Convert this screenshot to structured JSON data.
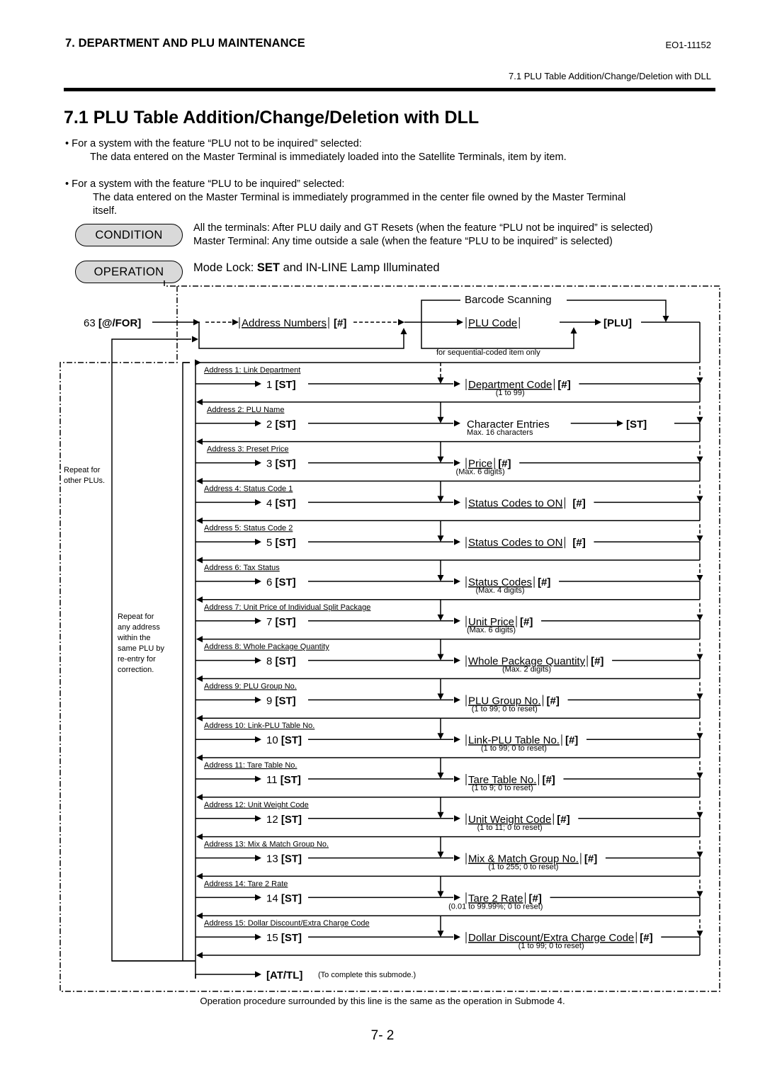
{
  "header": {
    "section": "7. DEPARTMENT AND PLU MAINTENANCE",
    "doc_code": "EO1-11152",
    "subheading": "7.1 PLU Table Addition/Change/Deletion with DLL"
  },
  "title": "7.1  PLU Table Addition/Change/Deletion with DLL",
  "bullets": [
    {
      "lead": "• For a system with the feature “PLU not to be inquired” selected:",
      "body": "The data entered on the Master Terminal is immediately loaded into the Satellite Terminals, item by item."
    },
    {
      "lead": "• For a system with the feature “PLU to be inquired” selected:",
      "body": "The data entered on the Master Terminal is immediately programmed  in the center file owned by the Master Terminal",
      "body2": "itself."
    }
  ],
  "condition": {
    "label": "CONDITION",
    "line1": "All the terminals: After PLU daily and GT Resets (when the feature “PLU not be inquired” is selected)",
    "line2": "Master Terminal: Any time outside a sale (when the feature “PLU to be inquired” is selected)"
  },
  "operation": {
    "label": "OPERATION",
    "prefix": "Mode Lock: ",
    "bold": "SET",
    "suffix": " and IN-LINE Lamp Illuminated"
  },
  "flow": {
    "start_num": "63 ",
    "start_key": "[@/FOR]",
    "address_numbers": "Address Numbers",
    "hash_key": "[#]",
    "barcode_scanning": "Barcode Scanning",
    "plu_code": "PLU Code",
    "plu_key": "[PLU]",
    "sequential_note": "for sequential-coded item only",
    "repeat_other": [
      "Repeat for",
      "other PLUs."
    ],
    "repeat_any": [
      "Repeat for",
      "any address",
      "within the",
      "same PLU by",
      "re-entry for",
      "correction."
    ],
    "end_key": "[AT/TL]",
    "end_note": "(To complete this submode.)",
    "st_key": "[ST]",
    "rows": [
      {
        "num": "1",
        "address": "Address 1: Link Department",
        "entry": "Department Code",
        "boxed": true,
        "hash": true,
        "note": "(1 to 99)"
      },
      {
        "num": "2",
        "address": "Address 2: PLU Name",
        "entry": "Character Entries",
        "boxed": false,
        "hash": false,
        "st_after": true,
        "note": "Max. 16 characters"
      },
      {
        "num": "3",
        "address": "Address 3: Preset Price",
        "entry": "Price",
        "boxed": true,
        "hash": true,
        "note": "(Max. 6 digits)"
      },
      {
        "num": "4",
        "address": "Address 4: Status Code 1",
        "entry": "Status Codes to ON",
        "boxed": true,
        "hash": true,
        "note": ""
      },
      {
        "num": "5",
        "address": "Address 5: Status Code 2",
        "entry": "Status Codes to ON",
        "boxed": true,
        "hash": true,
        "note": ""
      },
      {
        "num": "6",
        "address": "Address 6: Tax Status",
        "entry": "Status Codes",
        "boxed": true,
        "hash": true,
        "note": "(Max. 4 digits)"
      },
      {
        "num": "7",
        "address": "Address 7: Unit Price of Individual Split Package",
        "entry": "Unit Price",
        "boxed": true,
        "hash": true,
        "note": "(Max. 6 digits)"
      },
      {
        "num": "8",
        "address": "Address 8: Whole Package Quantity",
        "entry": "Whole Package Quantity",
        "boxed": true,
        "hash": true,
        "note": "(Max. 2 digits)"
      },
      {
        "num": "9",
        "address": "Address 9: PLU Group No.",
        "entry": "PLU Group No.",
        "boxed": true,
        "hash": true,
        "note": "(1 to 99; 0 to reset)"
      },
      {
        "num": "10",
        "address": "Address 10: Link-PLU Table No.",
        "entry": "Link-PLU Table No.",
        "boxed": true,
        "hash": true,
        "note": "(1 to 99; 0 to reset)"
      },
      {
        "num": "11",
        "address": "Address 11: Tare Table No.",
        "entry": "Tare Table No.",
        "boxed": true,
        "hash": true,
        "note": "(1 to 9; 0 to reset)"
      },
      {
        "num": "12",
        "address": "Address 12: Unit Weight Code",
        "entry": "Unit Weight Code",
        "boxed": true,
        "hash": true,
        "note": "(1 to 11; 0 to reset)"
      },
      {
        "num": "13",
        "address": "Address 13: Mix & Match Group No.",
        "entry": "Mix & Match Group No.",
        "boxed": true,
        "hash": true,
        "note": "(1 to 255; 0 to reset)"
      },
      {
        "num": "14",
        "address": "Address 14: Tare 2 Rate",
        "entry": "Tare 2 Rate",
        "boxed": true,
        "hash": true,
        "note": "(0.01 to 99.99%; 0 to reset)"
      },
      {
        "num": "15",
        "address": "Address 15: Dollar Discount/Extra Charge Code",
        "entry": "Dollar Discount/Extra Charge Code",
        "boxed": true,
        "hash": true,
        "note": "(1 to 99; 0 to reset)"
      }
    ]
  },
  "footnote": "Operation procedure surrounded by this line is the same as the operation in Submode 4.",
  "page_number": "7- 2"
}
